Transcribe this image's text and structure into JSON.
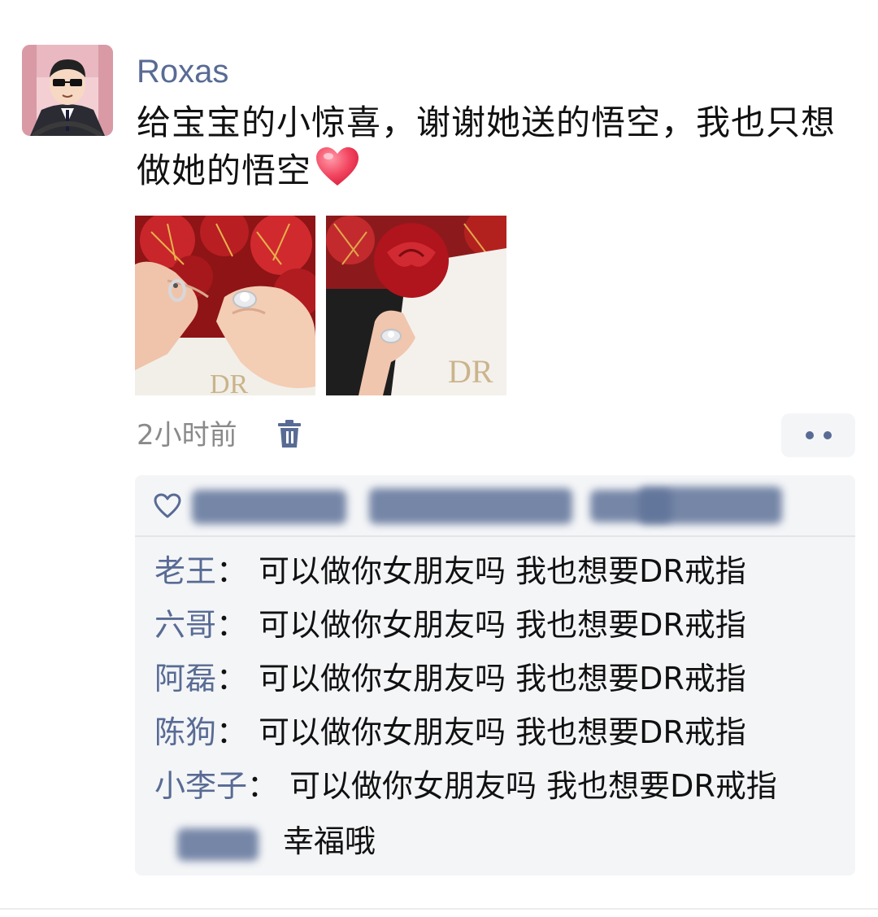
{
  "post": {
    "author": "Roxas",
    "text": "给宝宝的小惊喜，谢谢她送的悟空，我也只想做她的悟空",
    "emoji": "heart-emoji",
    "time": "2小时前",
    "photos": [
      {
        "name": "photo-rings-flowers"
      },
      {
        "name": "photo-rose-ring"
      }
    ]
  },
  "comments": [
    {
      "name": "老王",
      "sep": "：",
      "text": "可以做你女朋友吗 我也想要DR戒指"
    },
    {
      "name": "六哥",
      "sep": "：",
      "text": "可以做你女朋友吗 我也想要DR戒指"
    },
    {
      "name": "阿磊",
      "sep": "：",
      "text": "可以做你女朋友吗 我也想要DR戒指"
    },
    {
      "name": "陈狗",
      "sep": "：",
      "text": "可以做你女朋友吗 我也想要DR戒指"
    },
    {
      "name": "小李子",
      "sep": "：",
      "text": "可以做你女朋友吗 我也想要DR戒指"
    }
  ],
  "last_comment": {
    "text": "幸福哦"
  },
  "colors": {
    "link": "#586b94",
    "panel": "#f4f5f7",
    "time": "#8a8a8a"
  }
}
